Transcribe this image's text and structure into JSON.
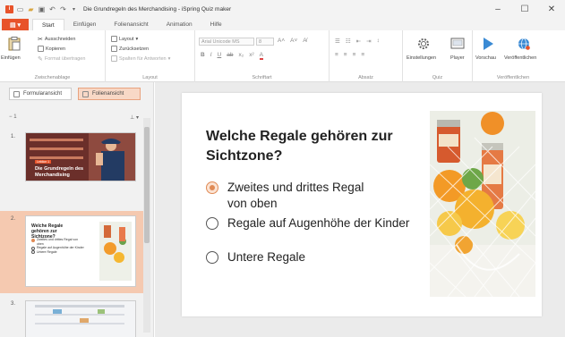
{
  "window": {
    "title": "Die Grundregeln des Merchandising - iSpring Quiz maker",
    "controls": {
      "minimize": "–",
      "maximize": "☐",
      "close": "✕"
    }
  },
  "ribbon_tabs": {
    "file": "",
    "tabs": [
      "Start",
      "Einfügen",
      "Folienansicht",
      "Animation",
      "Hilfe"
    ],
    "active": "Start"
  },
  "ribbon": {
    "clipboard": {
      "paste": "Einfügen",
      "cut": "Ausschneiden",
      "copy": "Kopieren",
      "format_painter": "Format übertragen",
      "label": "Zwischenablage"
    },
    "layout": {
      "layout": "Layout",
      "reset": "Zurücksetzen",
      "columns": "Spalten für Antworten",
      "label": "Layout"
    },
    "font": {
      "family": "Arial Unicode MS",
      "size": "8",
      "label": "Schriftart"
    },
    "paragraph": {
      "label": "Absatz"
    },
    "quiz": {
      "settings": "Einstellungen",
      "player": "Player",
      "label": "Quiz"
    },
    "publish": {
      "preview": "Vorschau",
      "publish": "Veröffentlichen",
      "label": "Veröffentlichen"
    }
  },
  "left_panel": {
    "form_view": "Formularansicht",
    "slide_view": "Folienansicht",
    "group_label": "1",
    "thumbnails": [
      {
        "num": "1.",
        "title": "Die Grundregeln des Merchandising",
        "tag": "Lektion 1"
      },
      {
        "num": "2.",
        "title": "Welche Regale gehören zur Sichtzone?",
        "answers": [
          "Zweites und drittes Regal von oben",
          "Regale auf Augenhöhe der Kinder",
          "Untere Regale"
        ]
      },
      {
        "num": "3."
      }
    ],
    "selected_index": 1
  },
  "slide": {
    "question": "Welche Regale gehören zur Sichtzone?",
    "answers": [
      {
        "text": "Zweites und drittes Regal von oben",
        "selected": true
      },
      {
        "text": "Regale auf Augenhöhe der Kinder",
        "selected": false
      },
      {
        "text": "Untere Regale",
        "selected": false
      }
    ],
    "image_icon": "grocery-net-bag-image"
  },
  "colors": {
    "accent": "#e8532a",
    "selection": "#f5c9b0",
    "radio_selected": "#e08a55"
  }
}
